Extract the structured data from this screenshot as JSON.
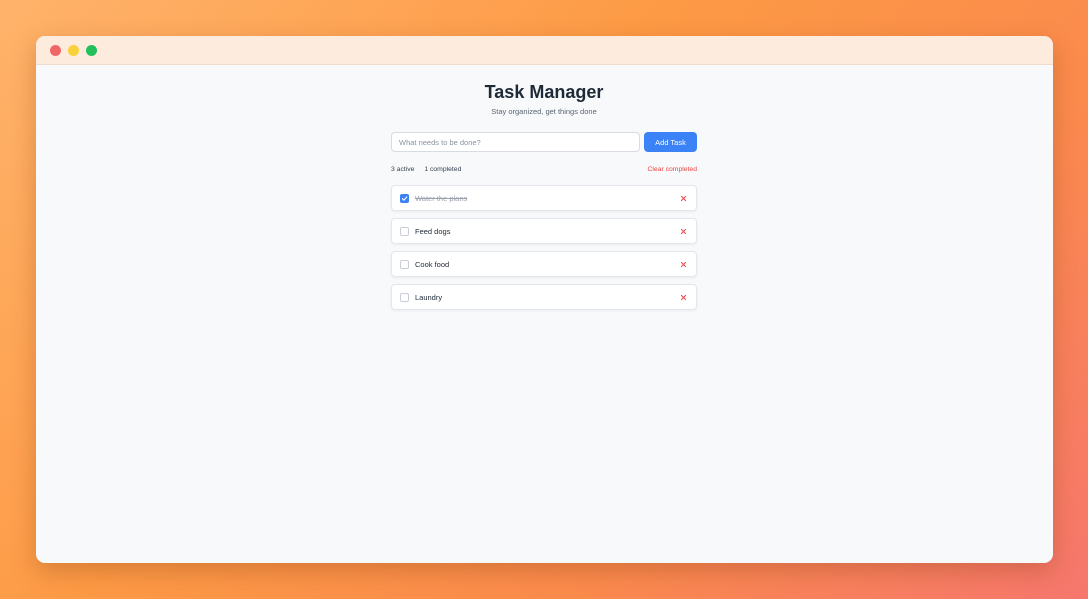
{
  "window": {
    "controls": [
      "close",
      "minimize",
      "maximize"
    ]
  },
  "header": {
    "title": "Task Manager",
    "subtitle": "Stay organized, get things done"
  },
  "new_task": {
    "placeholder": "What needs to be done?",
    "value": "",
    "add_label": "Add Task"
  },
  "stats": {
    "active": "3 active",
    "completed": "1 completed",
    "clear_label": "Clear completed"
  },
  "tasks": [
    {
      "text": "Water the plans",
      "done": true
    },
    {
      "text": "Feed dogs",
      "done": false
    },
    {
      "text": "Cook food",
      "done": false
    },
    {
      "text": "Laundry",
      "done": false
    }
  ],
  "colors": {
    "accent": "#3b82f6",
    "danger": "#ef4444",
    "title": "#1f2a37",
    "background_gradient": [
      "#ffb36b",
      "#f6766d"
    ]
  },
  "icons": {
    "check": "checkmark-icon",
    "delete": "close-x-icon"
  }
}
